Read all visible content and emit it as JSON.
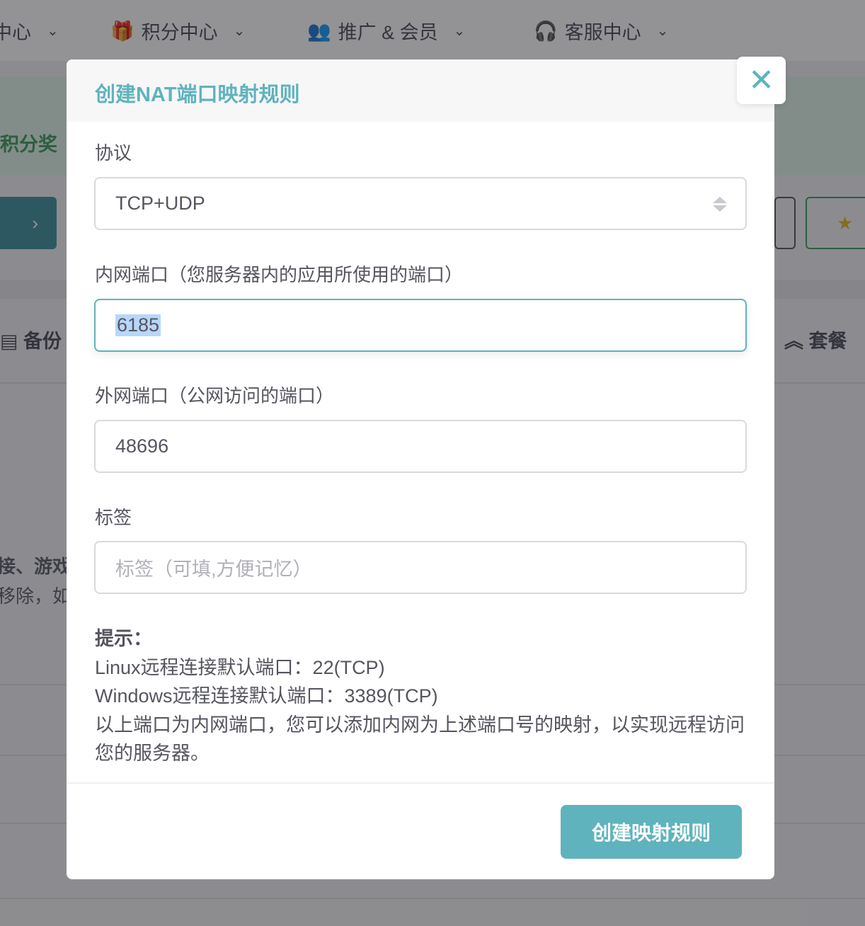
{
  "background": {
    "nav": [
      {
        "label": "中心",
        "icon": "menu-icon"
      },
      {
        "label": "积分中心",
        "icon": "gift-icon"
      },
      {
        "label": "推广 & 会员",
        "icon": "users-icon"
      },
      {
        "label": "客服中心",
        "icon": "headset-icon"
      }
    ],
    "banner_text": "积分奖",
    "section_left": "备份",
    "section_right": "套餐",
    "text_line1": "接、游戏",
    "text_line2": "移除，如"
  },
  "modal": {
    "title": "创建NAT端口映射规则",
    "close_label": "✕",
    "protocol": {
      "label": "协议",
      "value": "TCP+UDP"
    },
    "internal_port": {
      "label": "内网端口（您服务器内的应用所使用的端口）",
      "value": "6185"
    },
    "external_port": {
      "label": "外网端口（公网访问的端口）",
      "value": "48696"
    },
    "tag": {
      "label": "标签",
      "value": "",
      "placeholder": "标签（可填,方便记忆）"
    },
    "hint": {
      "title": "提示：",
      "lines": [
        "Linux远程连接默认端口：22(TCP)",
        "Windows远程连接默认端口：3389(TCP)",
        "以上端口为内网端口，您可以添加内网为上述端口号的映射，以实现远程访问您的服务器。"
      ]
    },
    "submit_label": "创建映射规则"
  },
  "colors": {
    "accent": "#5fb3bd",
    "overlay": "rgba(30,30,36,0.48)"
  }
}
